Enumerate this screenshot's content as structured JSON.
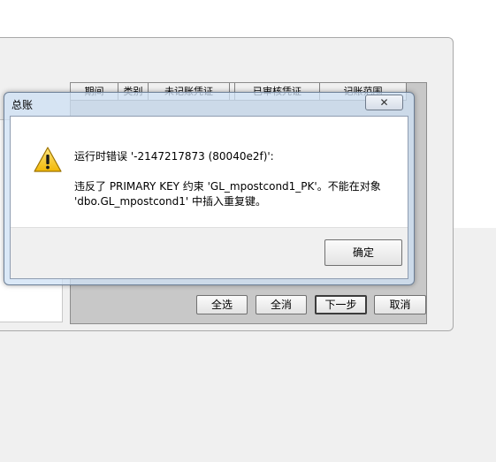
{
  "wizard": {
    "grid_headers": [
      "期间",
      "类别",
      "未记账凭证",
      "",
      "已审核凭证",
      "记账范围"
    ],
    "buttons": {
      "select_all": "全选",
      "clear_all": "全消",
      "next": "下一步",
      "cancel": "取消"
    }
  },
  "dialog": {
    "title": "总账",
    "close_glyph": "✕",
    "message_line1": "运行时错误 '-2147217873 (80040e2f)':",
    "message_line2": "违反了 PRIMARY KEY 约束 'GL_mpostcond1_PK'。不能在对象",
    "message_line3": "'dbo.GL_mpostcond1' 中插入重复键。",
    "ok_label": "确定",
    "icon": "warning-icon"
  }
}
